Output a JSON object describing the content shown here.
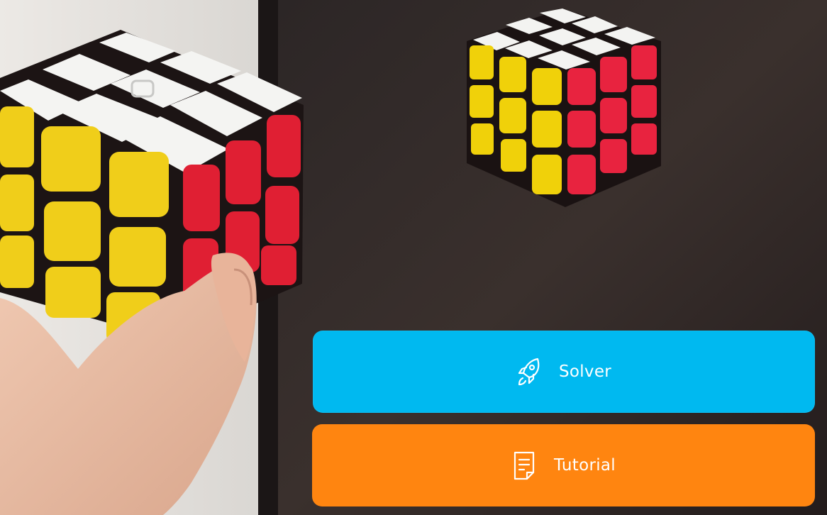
{
  "buttons": {
    "solver": {
      "label": "Solver",
      "color": "#00b9f0",
      "icon": "rocket-icon"
    },
    "tutorial": {
      "label": "Tutorial",
      "color": "#ff8510",
      "icon": "document-icon"
    }
  },
  "colors": {
    "cube_yellow": "#f0d10a",
    "cube_red": "#e8233f",
    "cube_white": "#f3f3f1",
    "screen_bg": "#2b2323"
  }
}
